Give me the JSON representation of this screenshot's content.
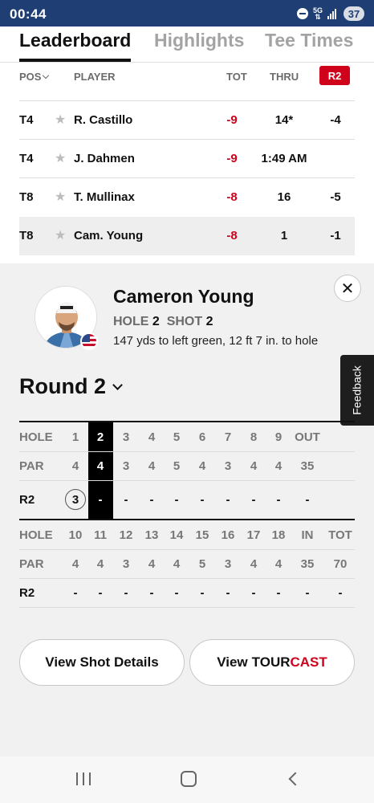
{
  "status_bar": {
    "time": "00:44",
    "network": "5G",
    "battery": "37"
  },
  "tabs": [
    {
      "label": "Leaderboard",
      "active": true
    },
    {
      "label": "Highlights",
      "active": false
    },
    {
      "label": "Tee Times",
      "active": false
    }
  ],
  "leaderboard": {
    "headers": {
      "pos": "POS",
      "player": "PLAYER",
      "tot": "TOT",
      "thru": "THRU",
      "round": "R2"
    },
    "rows": [
      {
        "pos": "T4",
        "player": "R. Castillo",
        "tot": "-9",
        "thru": "14*",
        "r2": "-4"
      },
      {
        "pos": "T4",
        "player": "J. Dahmen",
        "tot": "-9",
        "thru": "1:49 AM",
        "r2": ""
      },
      {
        "pos": "T8",
        "player": "T. Mullinax",
        "tot": "-8",
        "thru": "16",
        "r2": "-5"
      },
      {
        "pos": "T8",
        "player": "Cam. Young",
        "tot": "-8",
        "thru": "1",
        "r2": "-1"
      }
    ]
  },
  "player_card": {
    "name": "Cameron Young",
    "hole_label": "HOLE",
    "hole_value": "2",
    "shot_label": "SHOT",
    "shot_value": "2",
    "distance": "147 yds to left green, 12 ft 7 in. to hole",
    "feedback": "Feedback"
  },
  "scorecard": {
    "round_label": "Round 2",
    "front": {
      "hole_label": "HOLE",
      "par_label": "PAR",
      "round_label": "R2",
      "holes": [
        "1",
        "2",
        "3",
        "4",
        "5",
        "6",
        "7",
        "8",
        "9",
        "OUT"
      ],
      "par": [
        "4",
        "4",
        "3",
        "4",
        "5",
        "4",
        "3",
        "4",
        "4",
        "35"
      ],
      "scores": [
        "3",
        "-",
        "-",
        "-",
        "-",
        "-",
        "-",
        "-",
        "-",
        "-"
      ]
    },
    "back": {
      "hole_label": "HOLE",
      "par_label": "PAR",
      "round_label": "R2",
      "holes": [
        "10",
        "11",
        "12",
        "13",
        "14",
        "15",
        "16",
        "17",
        "18",
        "IN",
        "TOT"
      ],
      "par": [
        "4",
        "4",
        "3",
        "4",
        "4",
        "5",
        "3",
        "4",
        "4",
        "35",
        "70"
      ],
      "scores": [
        "-",
        "-",
        "-",
        "-",
        "-",
        "-",
        "-",
        "-",
        "-",
        "-",
        "-"
      ]
    }
  },
  "actions": {
    "shot_details": "View Shot Details",
    "tourcast_prefix": "View",
    "tourcast_tour": "TOUR",
    "tourcast_cast": "CAST"
  },
  "colors": {
    "accent_red": "#d0021b",
    "status_bar": "#1f3f74"
  }
}
